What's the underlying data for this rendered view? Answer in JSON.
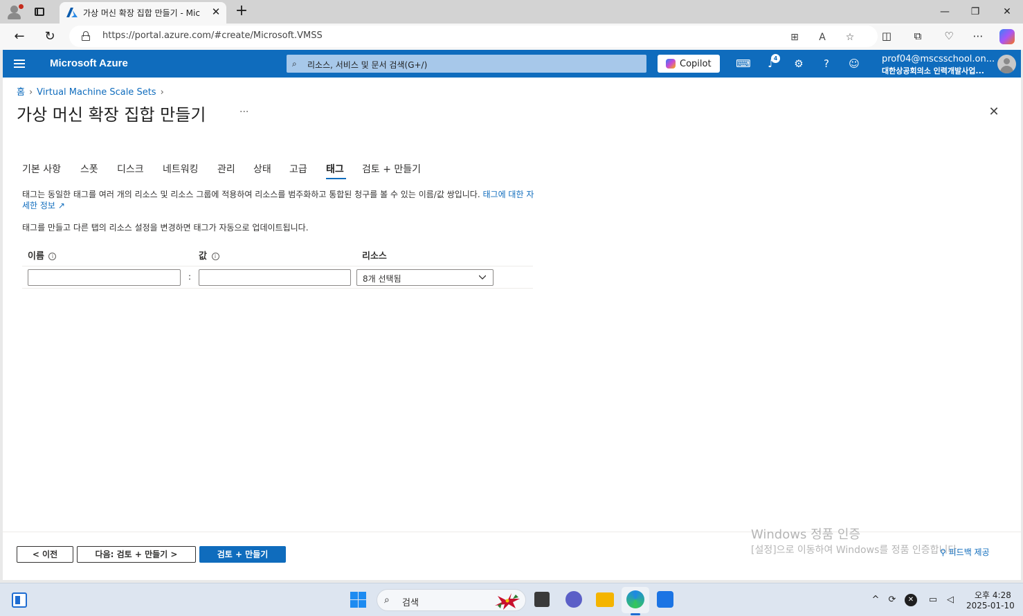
{
  "browser": {
    "tab_title": "가상 머신 확장 집합 만들기 - Mic",
    "url": "https://portal.azure.com/#create/Microsoft.VMSS",
    "new_tab": "+",
    "tab_close": "✕",
    "win_min": "—",
    "win_max": "❐",
    "win_close": "✕"
  },
  "header": {
    "brand": "Microsoft Azure",
    "search_placeholder": "리소스, 서비스 및 문서 검색(G+/)",
    "copilot_label": "Copilot",
    "notification_count": "4",
    "account_email": "prof04@mscsschool.on...",
    "account_org": "대한상공회의소 인력개발사업..."
  },
  "breadcrumb": {
    "home": "홈",
    "parent": "Virtual Machine Scale Sets"
  },
  "page": {
    "title": "가상 머신 확장 집합 만들기",
    "more": "···"
  },
  "tabs": [
    {
      "label": "기본 사항"
    },
    {
      "label": "스폿"
    },
    {
      "label": "디스크"
    },
    {
      "label": "네트워킹"
    },
    {
      "label": "관리"
    },
    {
      "label": "상태"
    },
    {
      "label": "고급"
    },
    {
      "label": "태그",
      "active": true
    },
    {
      "label": "검토 + 만들기"
    }
  ],
  "tags_tab": {
    "description": "태그는 동일한 태그를 여러 개의 리소스 및 리소스 그룹에 적용하여 리소스를 범주화하고 통합된 청구를 볼 수 있는 이름/값 쌍입니다.",
    "learn_more": "태그에 대한 자세한 정보",
    "note": "태그를 만들고 다른 탭의 리소스 설정을 변경하면 태그가 자동으로 업데이트됩니다.",
    "columns": {
      "name": "이름",
      "value": "값",
      "resources": "리소스"
    },
    "row": {
      "name": "",
      "value": "",
      "separator": ":",
      "resources": "8개 선택됨"
    }
  },
  "footer": {
    "prev": "< 이전",
    "next": "다음: 검토 + 만들기 >",
    "review_create": "검토 + 만들기",
    "feedback": "피드백 제공"
  },
  "watermark": {
    "title": "Windows 정품 인증",
    "subtitle": "[설정]으로 이동하여 Windows를 정품 인증합니다."
  },
  "taskbar": {
    "search_label": "검색",
    "time": "오후 4:28",
    "date": "2025-01-10"
  }
}
